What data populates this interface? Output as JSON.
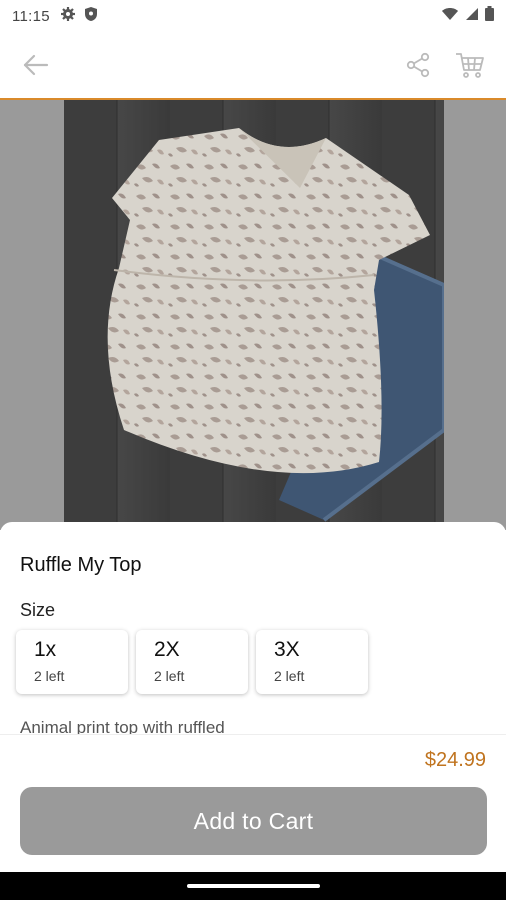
{
  "status_bar": {
    "time": "11:15"
  },
  "product": {
    "title": "Ruffle My Top",
    "size_label": "Size",
    "sizes": [
      {
        "name": "1x",
        "stock": "2 left"
      },
      {
        "name": "2X",
        "stock": "2 left"
      },
      {
        "name": "3X",
        "stock": "2 left"
      }
    ],
    "description": "Animal print top with ruffled",
    "price": "$24.99"
  },
  "actions": {
    "add_to_cart": "Add to Cart"
  },
  "colors": {
    "accent": "#d98a2b",
    "price": "#c0741f",
    "button": "#9a9a9a"
  }
}
